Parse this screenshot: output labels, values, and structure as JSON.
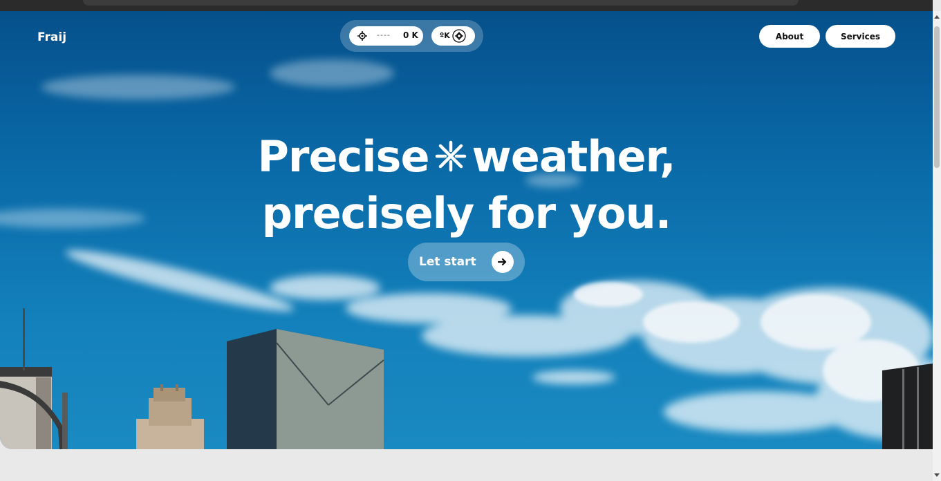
{
  "brand": {
    "name": "Fraij"
  },
  "location_widget": {
    "placeholder_dashes": "----",
    "temperature": "0 K",
    "unit_label": "ºK"
  },
  "nav": {
    "about_label": "About",
    "services_label": "Services"
  },
  "hero": {
    "headline_word1": "Precise",
    "headline_word2": "weather,",
    "headline_line2": "precisely for you.",
    "cta_label": "Let start"
  },
  "icons": {
    "location": "crosshair-icon",
    "settings": "gear-icon",
    "headline_glyph": "sparkle-icon",
    "cta": "arrow-right-icon"
  },
  "colors": {
    "sky_top": "#05508b",
    "sky_bottom": "#1a8ac2",
    "pill_bg": "#ffffff",
    "text_light": "#ffffff"
  }
}
